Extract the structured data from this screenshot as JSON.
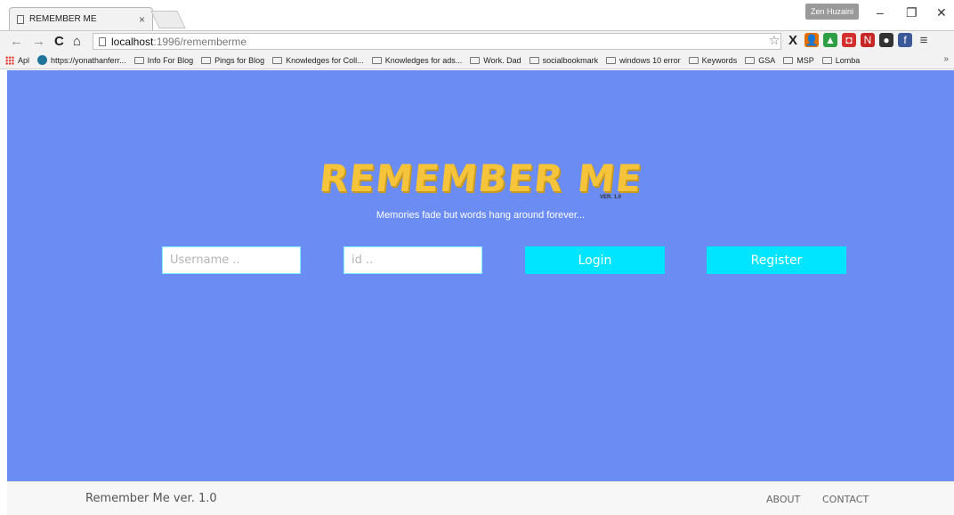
{
  "browser": {
    "tab_title": "REMEMBER ME",
    "tab_close": "×",
    "profile_name": "Zen Huzaini",
    "window_controls": {
      "minimize": "–",
      "restore": "❐",
      "close": "✕"
    },
    "nav": {
      "back": "←",
      "forward": "→",
      "reload": "C",
      "home": "⌂"
    },
    "address": {
      "host": "localhost",
      "path": ":1996/rememberme"
    },
    "star": "☆",
    "extensions": [
      {
        "name": "x-icon",
        "glyph": "X",
        "color": "#222222"
      },
      {
        "name": "person-icon",
        "glyph": "👤",
        "color": "#e07000"
      },
      {
        "name": "drive-icon",
        "glyph": "▲",
        "color": "#2e9e44"
      },
      {
        "name": "pocket-icon",
        "glyph": "◘",
        "color": "#d32f2f"
      },
      {
        "name": "new-badge-icon",
        "glyph": "N",
        "color": "#c62828"
      },
      {
        "name": "circle-icon",
        "glyph": "●",
        "color": "#333333"
      },
      {
        "name": "facebook-icon",
        "glyph": "f",
        "color": "#3b5998"
      }
    ],
    "menu": "≡",
    "bookmarks": [
      {
        "label": "Apl",
        "icon": "apps-icon"
      },
      {
        "label": "https://yonathanferr...",
        "icon": "wordpress-icon"
      },
      {
        "label": "Info For Blog",
        "icon": "folder-icon"
      },
      {
        "label": "Pings for Blog",
        "icon": "folder-icon"
      },
      {
        "label": "Knowledges for Coll...",
        "icon": "folder-icon"
      },
      {
        "label": "Knowledges for ads...",
        "icon": "folder-icon"
      },
      {
        "label": "Work. Dad",
        "icon": "folder-icon"
      },
      {
        "label": "socialbookmark",
        "icon": "folder-icon"
      },
      {
        "label": "windows 10 error",
        "icon": "folder-icon"
      },
      {
        "label": "Keywords",
        "icon": "folder-icon"
      },
      {
        "label": "GSA",
        "icon": "folder-icon"
      },
      {
        "label": "MSP",
        "icon": "folder-icon"
      },
      {
        "label": "Lomba",
        "icon": "folder-icon"
      }
    ],
    "bookmarks_more": "»"
  },
  "page": {
    "hero_color": "#6b8cf2",
    "logo_text": "REMEMBER ME",
    "logo_version": "VER. 1.0",
    "tagline": "Memories fade but words hang around forever...",
    "form": {
      "username_placeholder": "Username ..",
      "id_placeholder": "id ..",
      "login_label": "Login",
      "register_label": "Register",
      "button_color": "#00e5ff"
    },
    "footer": {
      "brand": "Remember Me ver. 1.0",
      "about_label": "ABOUT",
      "contact_label": "CONTACT"
    }
  }
}
